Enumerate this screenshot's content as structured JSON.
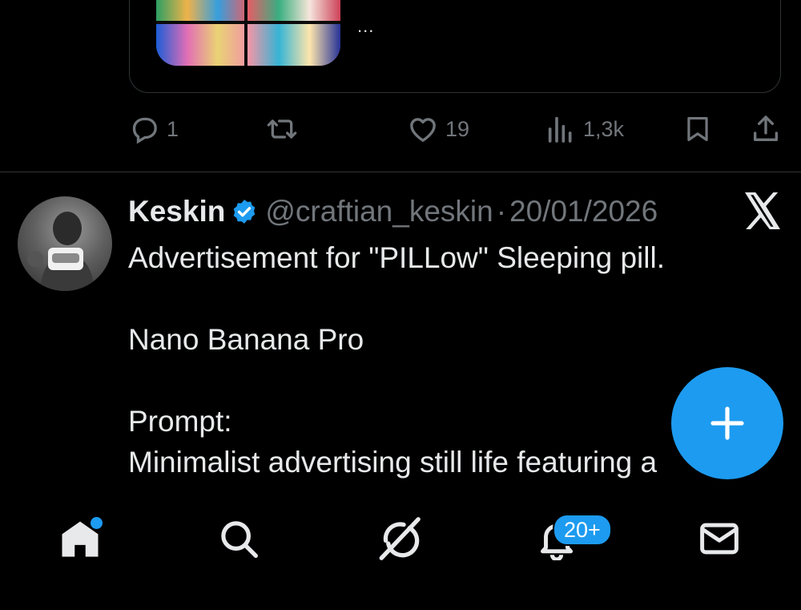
{
  "previous_post": {
    "more_label": "...",
    "stats": {
      "replies": "1",
      "likes": "19",
      "views": "1,3k"
    }
  },
  "post": {
    "author_name": "Keskin",
    "handle": "@craftian_keskin",
    "separator": "·",
    "date": "20/01/2026",
    "lines": [
      "Advertisement for \"PILLow\" Sleeping pill.",
      "",
      "Nano Banana Pro",
      "",
      "Prompt:",
      "Minimalist advertising still life featuring a"
    ]
  },
  "fab": {
    "icon": "plus-icon"
  },
  "nav": {
    "items": [
      {
        "name": "home",
        "icon": "home-icon"
      },
      {
        "name": "search",
        "icon": "search-icon"
      },
      {
        "name": "grok",
        "icon": "grok-icon"
      },
      {
        "name": "notifications",
        "icon": "bell-icon"
      },
      {
        "name": "messages",
        "icon": "mail-icon"
      }
    ],
    "notification_badge": "20+"
  },
  "colors": {
    "background": "#000000",
    "text": "#e7e9ea",
    "muted": "#71767b",
    "accent": "#1d9bf0",
    "border": "#2f3336"
  }
}
